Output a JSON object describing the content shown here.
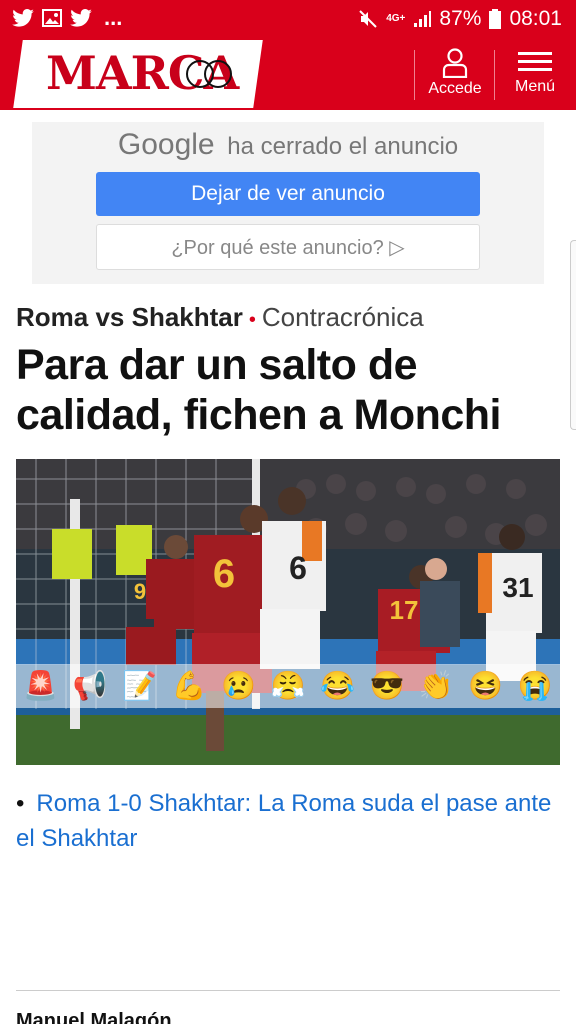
{
  "status_bar": {
    "left_icons": [
      "twitter-icon",
      "gallery-icon",
      "twitter-icon"
    ],
    "more": "...",
    "network": "4G+",
    "battery": "87%",
    "time": "08:01"
  },
  "header": {
    "logo": "MARCA",
    "login_label": "Accede",
    "menu_label": "Menú",
    "brand_color": "#d9001b"
  },
  "ad": {
    "google": "Google",
    "closed_text": "ha cerrado el anuncio",
    "stop_label": "Dejar de ver anuncio",
    "why_label": "¿Por qué este anuncio? ▷"
  },
  "article": {
    "kicker_team": "Roma vs Shakhtar",
    "kicker_section": "Contracrónica",
    "headline": "Para dar un salto de calidad, fichen a Monchi",
    "photo_numbers": [
      "9",
      "6",
      "6",
      "17",
      "31"
    ],
    "reactions": [
      "🚨",
      "📢",
      "📝",
      "💪",
      "😢",
      "😤",
      "😂",
      "😎",
      "👏",
      "😆",
      "😭"
    ],
    "related_link": "Roma 1-0 Shakhtar: La Roma suda el pase ante el Shakhtar",
    "author": "Manuel Malagón"
  }
}
